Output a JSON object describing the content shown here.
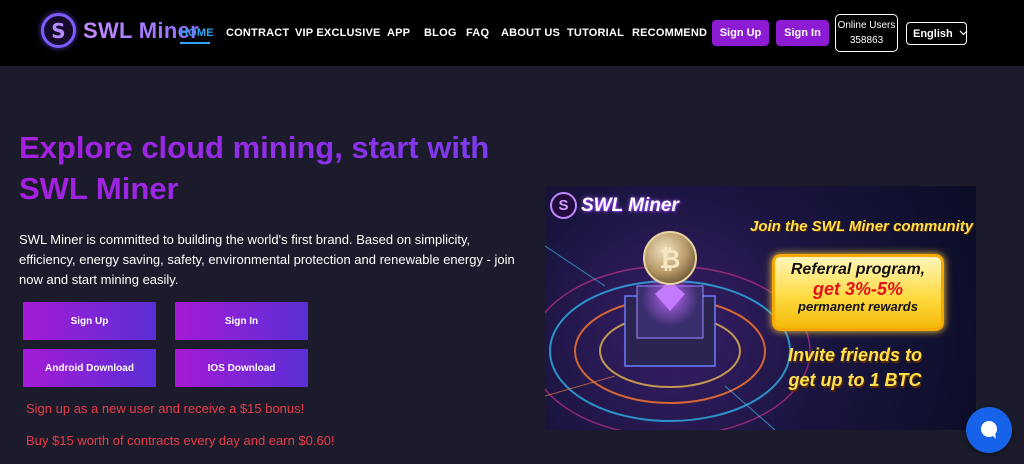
{
  "brand": {
    "name": "SWL Miner",
    "mark": "S"
  },
  "nav": {
    "items": [
      {
        "label": "HOME",
        "active": true
      },
      {
        "label": "CONTRACT"
      },
      {
        "label": "VIP EXCLUSIVE"
      },
      {
        "label": "APP"
      },
      {
        "label": "BLOG"
      },
      {
        "label": "FAQ"
      },
      {
        "label": "ABOUT US"
      },
      {
        "label": "TUTORIAL"
      },
      {
        "label": "RECOMMEND"
      }
    ],
    "signup_label": "Sign Up",
    "signin_label": "Sign In",
    "online_users_label": "Online Users",
    "online_users_count": "358863",
    "language": "English"
  },
  "hero": {
    "title": "Explore cloud mining, start with SWL Miner",
    "description": "SWL Miner is committed to building the world's first brand. Based on simplicity, efficiency, energy saving, safety, environmental protection and renewable energy - join now and start mining easily.",
    "buttons": {
      "signup": "Sign Up",
      "signin": "Sign In",
      "android": "Android Download",
      "ios": "IOS Download"
    },
    "promo_1": "Sign up as a new user and receive a $15 bonus!",
    "promo_2": "Buy $15 worth of contracts every day and earn $0.60!"
  },
  "banner": {
    "logo_text": "SWL Miner",
    "join": "Join the SWL Miner community",
    "card_line1": "Referral program,",
    "card_line2": "get 3%-5%",
    "card_line3": "permanent rewards",
    "invite_line1": "Invite friends to",
    "invite_line2": "get up to 1 BTC"
  },
  "colors": {
    "accent": "#8e1bd4",
    "nav_active": "#2fa3f4",
    "promo": "#ea3b48",
    "background": "#1c1b2b"
  }
}
